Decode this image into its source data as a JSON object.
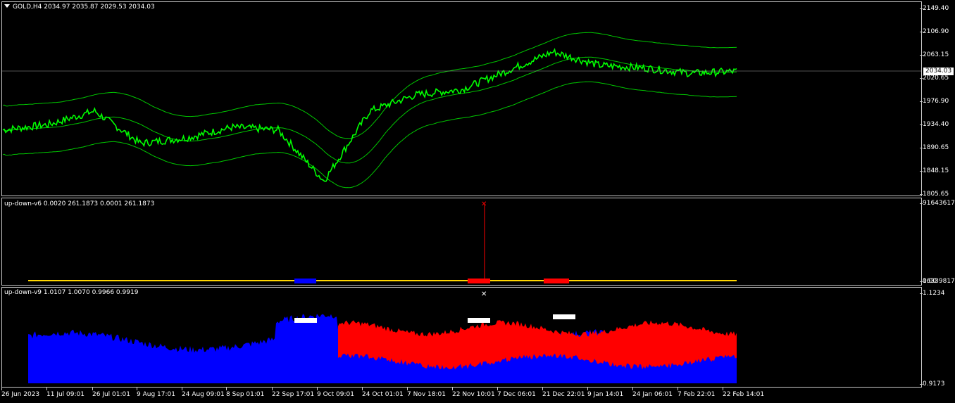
{
  "window": {
    "symbol_menu_icon": "down-triangle-icon",
    "title": "GOLD,H4  2034.97 2035.87 2029.53 2034.03"
  },
  "colors": {
    "price": "#00ff00",
    "bands": "#00c800",
    "level": "#ffd700",
    "up": "#0000ff",
    "down": "#ff0000",
    "marker": "#ffffff"
  },
  "main_pane": {
    "price_ticks": [
      "2149.40",
      "2106.90",
      "2063.15",
      "2020.65",
      "1976.90",
      "1934.40",
      "1890.65",
      "1848.15",
      "1805.65"
    ],
    "current_price": "2034.03"
  },
  "indicator_v6": {
    "title": "up-down-v6 0.0020 261.1873 0.0001 261.1873",
    "scale_top": "91643617",
    "scale_bottom": "0.00",
    "scale_bottom_overlap": "16339817"
  },
  "indicator_v9": {
    "title": "up-down-v9 1.0107 1.0070 0.9966 0.9919",
    "scale_top": "1.1234",
    "scale_bottom": "0.9173"
  },
  "time_axis": [
    "26 Jun 2023",
    "11 Jul 09:01",
    "26 Jul 01:01",
    "9 Aug 17:01",
    "24 Aug 09:01",
    "8 Sep 01:01",
    "22 Sep 17:01",
    "9 Oct 09:01",
    "24 Oct 01:01",
    "7 Nov 18:01",
    "22 Nov 10:01",
    "7 Dec 06:01",
    "21 Dec 22:01",
    "9 Jan 14:01",
    "24 Jan 06:01",
    "7 Feb 22:01",
    "22 Feb 14:01"
  ],
  "chart_data": {
    "type": "line",
    "x": [
      "26 Jun 2023",
      "11 Jul 09:01",
      "26 Jul 01:01",
      "9 Aug 17:01",
      "24 Aug 09:01",
      "8 Sep 01:01",
      "22 Sep 17:01",
      "9 Oct 09:01",
      "24 Oct 01:01",
      "7 Nov 18:01",
      "22 Nov 10:01",
      "7 Dec 06:01",
      "21 Dec 22:01",
      "9 Jan 14:01",
      "24 Jan 06:01",
      "7 Feb 22:01",
      "22 Feb 14:01"
    ],
    "series": [
      {
        "values": [
          1925,
          1935,
          1960,
          1900,
          1910,
          1930,
          1925,
          1830,
          1960,
          1990,
          2000,
          2035,
          2070,
          2045,
          2040,
          2030,
          2034
        ]
      }
    ],
    "ylim": [
      1805.65,
      2149.4
    ],
    "grid": false
  }
}
